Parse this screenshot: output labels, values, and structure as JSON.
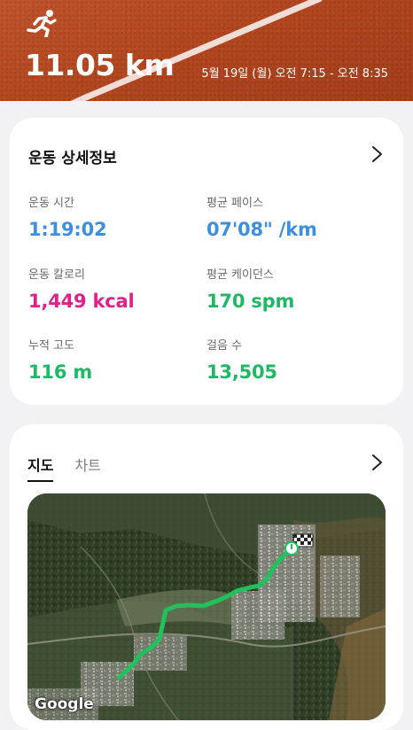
{
  "header": {
    "distance": "11.05 km",
    "datetime": "5월 19일 (월) 오전 7:15 - 오전 8:35"
  },
  "details": {
    "title": "운동 상세정보",
    "metrics": [
      {
        "label": "운동 시간",
        "value": "1:19:02",
        "color": "#3e8fdc"
      },
      {
        "label": "평균 페이스",
        "value": "07'08\" /km",
        "color": "#3e8fdc"
      },
      {
        "label": "운동 칼로리",
        "value": "1,449 kcal",
        "color": "#e0218a"
      },
      {
        "label": "평균 케이던스",
        "value": "170 spm",
        "color": "#1fb866"
      },
      {
        "label": "누적 고도",
        "value": "116 m",
        "color": "#1fb866"
      },
      {
        "label": "걸음 수",
        "value": "13,505",
        "color": "#1fb866"
      }
    ]
  },
  "map_card": {
    "tabs": [
      {
        "label": "지도",
        "active": true
      },
      {
        "label": "차트",
        "active": false
      }
    ],
    "attribution": "Google",
    "route_color": "#21c25e"
  },
  "icons": {
    "runner": "runner-icon",
    "chevron": "chevron-right-icon",
    "start": "start-marker-icon",
    "finish": "finish-flag-icon"
  }
}
